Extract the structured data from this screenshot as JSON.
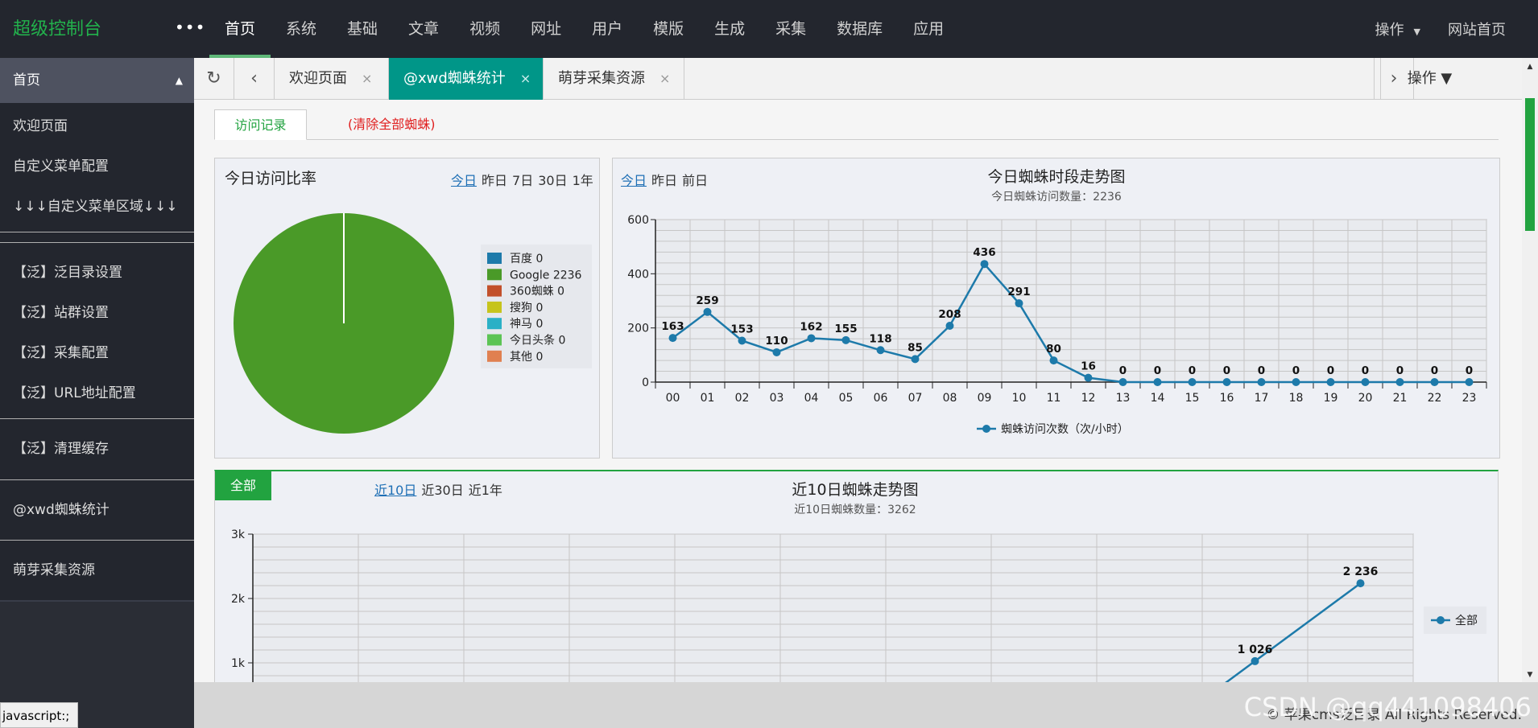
{
  "header": {
    "brand": "超级控制台",
    "more_label": "•••",
    "nav": [
      "首页",
      "系统",
      "基础",
      "文章",
      "视频",
      "网址",
      "用户",
      "模版",
      "生成",
      "采集",
      "数据库",
      "应用"
    ],
    "operate": "操作",
    "site_home": "网站首页"
  },
  "sidebar": {
    "head": "首页",
    "items": [
      "欢迎页面",
      "自定义菜单配置",
      "↓↓↓自定义菜单区域↓↓↓"
    ],
    "fan": [
      "【泛】泛目录设置",
      "【泛】站群设置",
      "【泛】采集配置",
      "【泛】URL地址配置"
    ],
    "cache": "【泛】清理缓存",
    "xwd": "@xwd蜘蛛统计",
    "mengya": "萌芽采集资源"
  },
  "tabs": {
    "items": [
      {
        "label": "欢迎页面"
      },
      {
        "label": "@xwd蜘蛛统计"
      },
      {
        "label": "萌芽采集资源"
      }
    ],
    "close": "×",
    "operate": "操作 ▼"
  },
  "subtabs": {
    "visit": "访问记录",
    "clear": "(清除全部蜘蛛)"
  },
  "pie": {
    "title": "今日访问比率",
    "links": [
      "今日",
      "昨日",
      "7日",
      "30日",
      "1年"
    ]
  },
  "hour": {
    "links": [
      "今日",
      "昨日",
      "前日"
    ]
  },
  "ten": {
    "badge": "全部",
    "links": [
      "近10日",
      "近30日",
      "近1年"
    ]
  },
  "colors": {
    "sidebar": "#393d49",
    "header": "#23262e",
    "accent": "#22a340",
    "active_tab": "#009688",
    "line": "#1d7aaa"
  },
  "chart_data": [
    {
      "type": "pie",
      "title": "",
      "series": [
        {
          "name": "百度",
          "value": 0,
          "color": "#1d7aaa"
        },
        {
          "name": "Google",
          "value": 2236,
          "color": "#4a9a28"
        },
        {
          "name": "360蜘蛛",
          "value": 0,
          "color": "#c2502a"
        },
        {
          "name": "搜狗",
          "value": 0,
          "color": "#c6c41c"
        },
        {
          "name": "神马",
          "value": 0,
          "color": "#2ab0c6"
        },
        {
          "name": "今日头条",
          "value": 0,
          "color": "#5cc454"
        },
        {
          "name": "其他",
          "value": 0,
          "color": "#e08050"
        }
      ],
      "legend_position": "right"
    },
    {
      "type": "line",
      "title": "今日蜘蛛时段走势图",
      "subtitle": "今日蜘蛛访问数量：2236",
      "categories": [
        "00",
        "01",
        "02",
        "03",
        "04",
        "05",
        "06",
        "07",
        "08",
        "09",
        "10",
        "11",
        "12",
        "13",
        "14",
        "15",
        "16",
        "17",
        "18",
        "19",
        "20",
        "21",
        "22",
        "23"
      ],
      "series": [
        {
          "name": "蜘蛛访问次数（次/小时）",
          "values": [
            163,
            259,
            153,
            110,
            162,
            155,
            118,
            85,
            208,
            436,
            291,
            80,
            16,
            0,
            0,
            0,
            0,
            0,
            0,
            0,
            0,
            0,
            0,
            0
          ]
        }
      ],
      "ylim": [
        0,
        600
      ],
      "yticks": [
        "0",
        "200",
        "400",
        "600"
      ],
      "grid": true,
      "legend_position": "bottom"
    },
    {
      "type": "line",
      "title": "近10日蜘蛛走势图",
      "subtitle": "近10日蜘蛛数量：3262",
      "series": [
        {
          "name": "全部",
          "labels": [
            "1 026",
            "2 236"
          ]
        }
      ],
      "yticks": [
        "1k",
        "2k",
        "3k"
      ],
      "ylim": [
        0,
        3000
      ],
      "grid": true,
      "legend_position": "right"
    }
  ],
  "footer": {
    "copyright": "© 苹果cms泛目录 All Rights Reserved.",
    "watermark": "CSDN @qq441098406"
  },
  "status_text": "javascript:;"
}
